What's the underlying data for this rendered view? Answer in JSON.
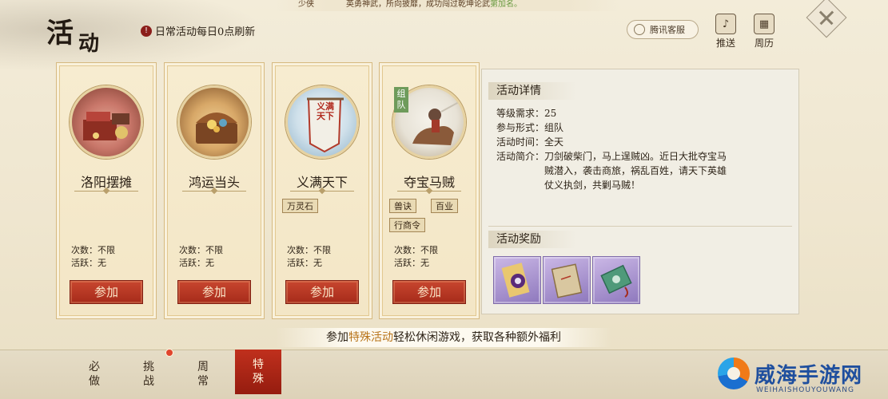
{
  "top_strip": {
    "player_name": "少侠",
    "message": "英勇神武，所向披靡，成功闯过乾坤论武",
    "suffix": "第加名。"
  },
  "header": {
    "title": "活",
    "title_small": "动",
    "notice": "日常活动每日0点刷新",
    "notice_icon": "!",
    "service_label": "腾讯客服",
    "tools": [
      {
        "label": "推送",
        "icon": "bell-icon",
        "glyph": "♪"
      },
      {
        "label": "周历",
        "icon": "calendar-icon",
        "glyph": "▦"
      }
    ]
  },
  "cards": [
    {
      "name": "洛阳摆摊",
      "tags": [],
      "count_label": "次数：",
      "count_value": "不限",
      "active_label": "活跃：",
      "active_value": "无",
      "join_label": "参加",
      "portrait_colors": [
        "#c9776a",
        "#7c3b2e"
      ]
    },
    {
      "name": "鸿运当头",
      "tags": [],
      "count_label": "次数：",
      "count_value": "不限",
      "active_label": "活跃：",
      "active_value": "无",
      "join_label": "参加",
      "portrait_colors": [
        "#d8a868",
        "#7c4e26"
      ]
    },
    {
      "name": "义满天下",
      "tags": [
        "万灵石"
      ],
      "banner_text": "义满天下",
      "count_label": "次数：",
      "count_value": "不限",
      "active_label": "活跃：",
      "active_value": "无",
      "join_label": "参加",
      "portrait_colors": [
        "#cfe0ea",
        "#8fb2c9"
      ]
    },
    {
      "name": "夺宝马贼",
      "badge": "组队",
      "tags": [
        "兽诀",
        "百业",
        "行商令"
      ],
      "count_label": "次数：",
      "count_value": "不限",
      "active_label": "活跃：",
      "active_value": "无",
      "join_label": "参加",
      "portrait_colors": [
        "#e7e2d6",
        "#b9a98f"
      ]
    }
  ],
  "detail": {
    "title": "活动详情",
    "level_label": "等级需求：",
    "level_value": "25",
    "form_label": "参与形式：",
    "form_value": "组队",
    "time_label": "活动时间：",
    "time_value": "全天",
    "intro_label": "活动简介：",
    "intro_value": "刀剑破柴门，马上逞贼凶。近日大批夺宝马贼潜入，袭击商旅，祸乱百姓，请天下英雄仗义执剑，共剿马贼！",
    "reward_title": "活动奖励",
    "rewards": [
      {
        "icon": "scroll-icon"
      },
      {
        "icon": "book-icon"
      },
      {
        "icon": "token-icon"
      }
    ]
  },
  "tip": {
    "before": "参加",
    "highlight": "特殊活动",
    "after": "轻松休闲游戏，获取各种额外福利"
  },
  "bottom_tabs": [
    {
      "label": [
        "必",
        "做"
      ],
      "active": false
    },
    {
      "label": [
        "挑",
        "战"
      ],
      "active": false
    },
    {
      "label": [
        "周",
        "常"
      ],
      "active": false
    },
    {
      "label": [
        "特",
        "殊"
      ],
      "active": true
    }
  ],
  "watermark": {
    "brand": "威海手游网",
    "url": "WEIHAISHOUYOUWANG"
  }
}
